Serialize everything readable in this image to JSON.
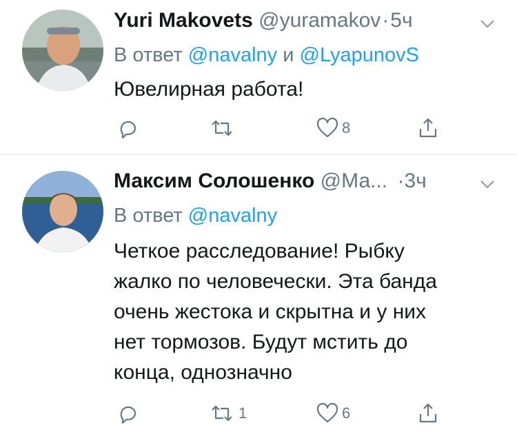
{
  "tweets": [
    {
      "name": "Yuri Makovets",
      "handle": "@yuramakov",
      "dot": "·",
      "time": "5ч",
      "reply_prefix": "В ответ",
      "mention_1": "@navalny",
      "reply_and": "и",
      "mention_2": "@LyapunovS",
      "text_lines": [
        "Ювелирная работа!"
      ],
      "reply_count": "",
      "retweet_count": "",
      "like_count": "8"
    },
    {
      "name": "Максим Солошенко",
      "handle": "@Ма...",
      "dot": "·",
      "time": "3ч",
      "reply_prefix": "В ответ",
      "mention_1": "@navalny",
      "text_lines": [
        "Четкое расследование! Рыбку",
        "жалко по человечески. Эта банда",
        "очень жестока и скрытна и у них",
        "нет тормозов. Будут мстить до",
        "конца, однозначно"
      ],
      "reply_count": "",
      "retweet_count": "1",
      "like_count": "6"
    }
  ],
  "icons": {
    "reply": "reply-icon",
    "retweet": "retweet-icon",
    "like": "heart-icon",
    "share": "share-icon",
    "more": "chevron-down-icon"
  },
  "colors": {
    "text": "#14171a",
    "secondary": "#657786",
    "link": "#1da1f2",
    "divider": "#e1e8ed"
  }
}
